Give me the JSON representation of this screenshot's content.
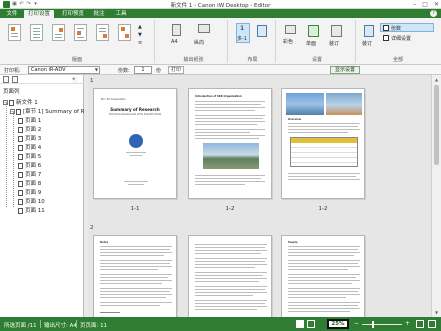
{
  "window": {
    "title": "新文件 1 - Canon iW Desktop - Editor",
    "controls": [
      "–",
      "□",
      "✕"
    ]
  },
  "tabs": [
    {
      "label": "文件",
      "active": false
    },
    {
      "label": "打印设置",
      "active": true
    },
    {
      "label": "打印预览",
      "active": false
    },
    {
      "label": "批注",
      "active": false
    },
    {
      "label": "工具",
      "active": false
    }
  ],
  "ribbon": {
    "group_captions": [
      "版面",
      "输出纸张",
      "布局",
      "设置",
      "全部"
    ],
    "paper_size": "A4",
    "orientation": "纵向",
    "pages_per_sheet_label": "多-1",
    "pages_per_sheet_value": "1",
    "color_label": "彩色",
    "duplex_label": "单面",
    "staple_label": "装订",
    "finish_label": "分页",
    "merge_label": "装订",
    "settings_check_1": "份数",
    "settings_check_2": "详细设置"
  },
  "printerbar": {
    "printer_label": "打印机:",
    "printer_value": "Canon iR-ADV",
    "copies_label": "份数:",
    "copies_value": "1",
    "range_label": "份",
    "print_button": "打印",
    "settings_button": "显示设置"
  },
  "navpane": {
    "title": "页面列",
    "tree": [
      {
        "label": "新文件 1",
        "level": 0,
        "expander": "−",
        "type": "doc"
      },
      {
        "label": "[章节 1] Summary of Re",
        "level": 1,
        "expander": "−",
        "type": "doc"
      },
      {
        "label": "页面 1",
        "level": 2,
        "expander": "",
        "type": "page"
      },
      {
        "label": "页面 2",
        "level": 2,
        "expander": "",
        "type": "page"
      },
      {
        "label": "页面 3",
        "level": 2,
        "expander": "",
        "type": "page"
      },
      {
        "label": "页面 4",
        "level": 2,
        "expander": "",
        "type": "page"
      },
      {
        "label": "页面 5",
        "level": 2,
        "expander": "",
        "type": "page"
      },
      {
        "label": "页面 6",
        "level": 2,
        "expander": "",
        "type": "page"
      },
      {
        "label": "页面 7",
        "level": 2,
        "expander": "",
        "type": "page"
      },
      {
        "label": "页面 8",
        "level": 2,
        "expander": "",
        "type": "page"
      },
      {
        "label": "页面 9",
        "level": 2,
        "expander": "",
        "type": "page"
      },
      {
        "label": "页面 10",
        "level": 2,
        "expander": "",
        "type": "page"
      },
      {
        "label": "页面 11",
        "level": 2,
        "expander": "",
        "type": "page"
      }
    ]
  },
  "pages": [
    {
      "number": "1",
      "label": "1-1",
      "title": "Summary of Research",
      "subtitle": "The Future Development of the Scientific Model",
      "company": "Pro. XX Corporation"
    },
    {
      "number": "",
      "label": "1-2",
      "title": "Introduction of SRR Organization"
    },
    {
      "number": "",
      "label": "1-2",
      "title": "Overview"
    },
    {
      "number": "2",
      "label": "",
      "title": "Notes"
    },
    {
      "number": "",
      "label": "",
      "title": ""
    },
    {
      "number": "",
      "label": "",
      "title": "People"
    }
  ],
  "statusbar": {
    "pages_text": "所选页面 /11",
    "paper_text": "输出尺寸: A4",
    "count_text": "页页面: 11",
    "zoom": "25%",
    "minus": "−",
    "plus": "+"
  },
  "colors": {
    "accent_green": "#2e7d32",
    "ribbon_bg": "#f3f3f3",
    "view_bg": "#e6e6e6"
  }
}
